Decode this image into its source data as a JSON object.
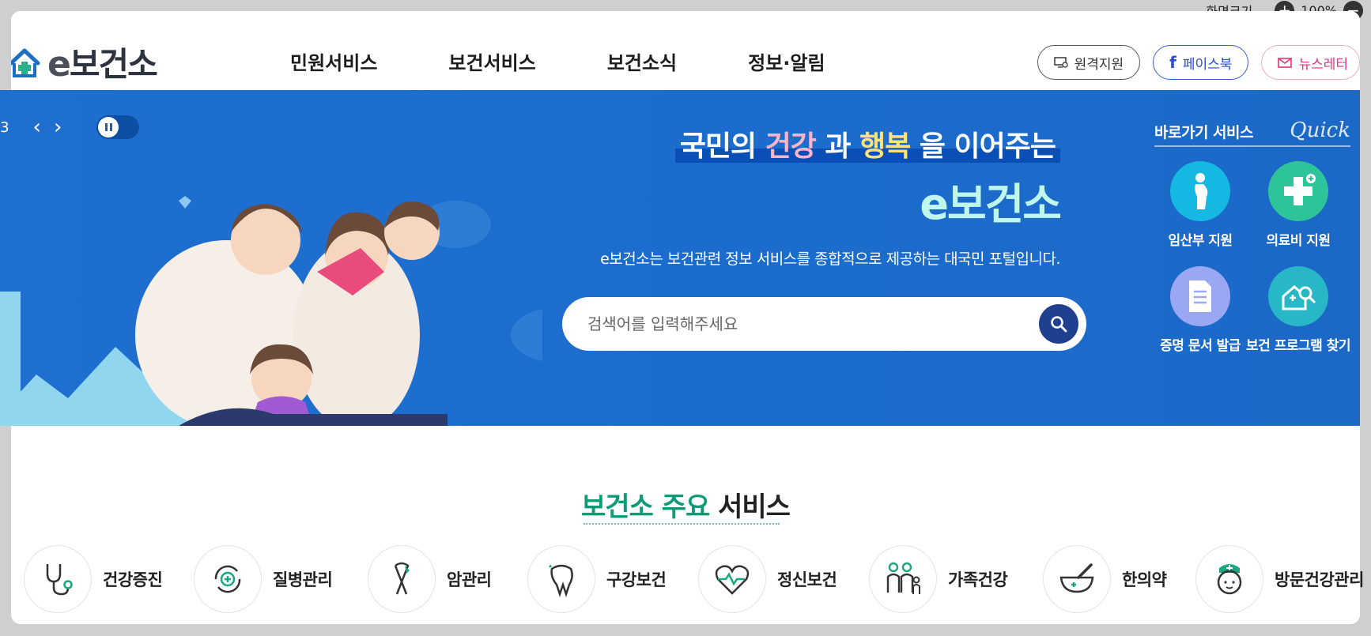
{
  "zoom": {
    "label": "화면크기",
    "value": "100%",
    "plus_icon": "plus-icon",
    "minus_icon": "minus-icon"
  },
  "header": {
    "logo_e": "e",
    "logo_text": "보건소",
    "nav": [
      "민원서비스",
      "보건서비스",
      "보건소식",
      "정보·알림"
    ],
    "util": {
      "remote": "원격지원",
      "facebook": "페이스북",
      "facebook_f": "f",
      "newsletter": "뉴스레터"
    }
  },
  "hero": {
    "counter_sep": "/",
    "counter_total": "3",
    "tagline": {
      "p1": "국민의 ",
      "w1": "건강",
      "p2": " 과 ",
      "w2": "행복",
      "p3": " 을 이어주는"
    },
    "brand": "e보건소",
    "description": "e보건소는 보건관련 정보 서비스를 종합적으로 제공하는 대국민 포털입니다.",
    "search_placeholder": "검색어를 입력해주세요"
  },
  "quick": {
    "title": "바로가기 서비스",
    "script": "Quick",
    "items": [
      {
        "label": "임산부 지원",
        "icon": "pregnant-icon",
        "color": "#15b8e0"
      },
      {
        "label": "의료비 지원",
        "icon": "medical-cross-icon",
        "color": "#2ec49a"
      },
      {
        "label": "증명 문서 발급",
        "icon": "document-icon",
        "color": "#9aa8f4"
      },
      {
        "label": "보건 프로그램 찾기",
        "icon": "search-home-icon",
        "color": "#27b7c7"
      }
    ]
  },
  "section": {
    "title_green": "보건소 주요",
    "title_dark": " 서비스"
  },
  "services": [
    {
      "label": "건강증진",
      "icon": "stethoscope-icon"
    },
    {
      "label": "질병관리",
      "icon": "recycle-cross-icon"
    },
    {
      "label": "암관리",
      "icon": "ribbon-icon"
    },
    {
      "label": "구강보건",
      "icon": "tooth-icon"
    },
    {
      "label": "정신보건",
      "icon": "heartbeat-icon"
    },
    {
      "label": "가족건강",
      "icon": "family-icon"
    },
    {
      "label": "한의약",
      "icon": "mortar-icon"
    },
    {
      "label": "방문건강관리",
      "icon": "nurse-icon"
    }
  ],
  "colors": {
    "hero_blue": "#1c6ccd",
    "accent_green": "#0f9a78",
    "brand_mint": "#bff7ee",
    "search_btn": "#1f3f8f"
  }
}
